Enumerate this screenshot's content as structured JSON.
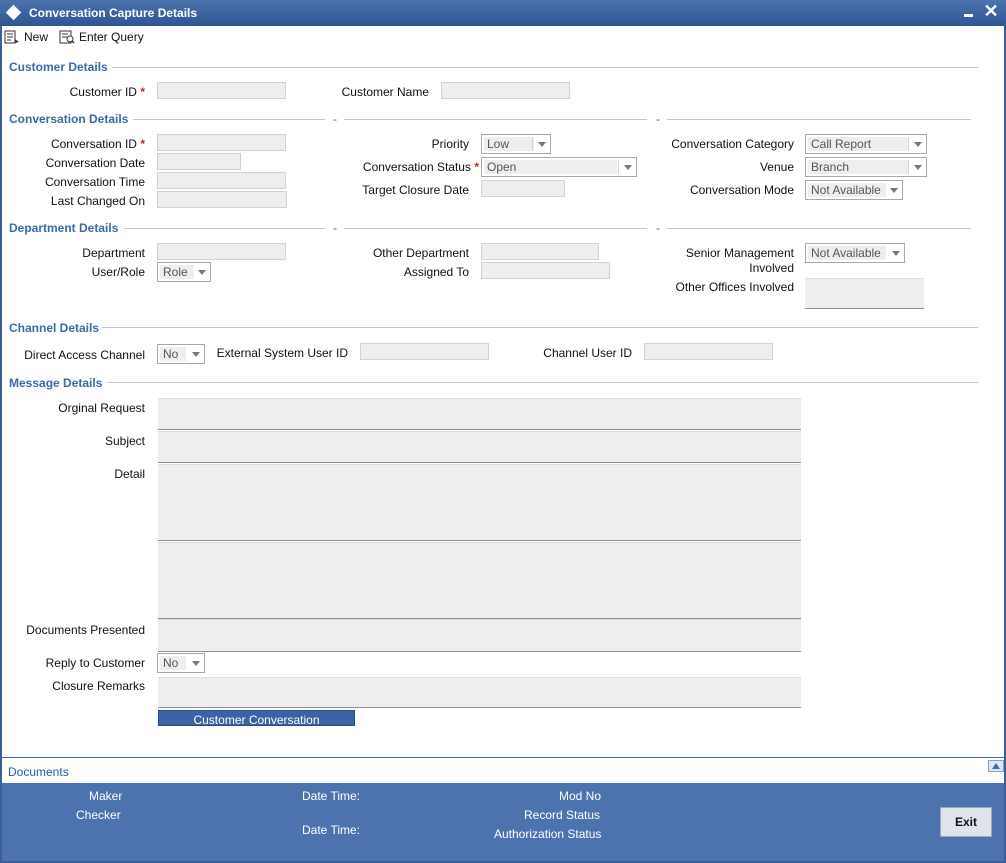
{
  "window": {
    "title": "Conversation Capture Details"
  },
  "toolbar": {
    "new_label": "New",
    "enter_query_label": "Enter Query"
  },
  "sections": {
    "customer": "Customer Details",
    "conversation": "Conversation Details",
    "department": "Department Details",
    "channel": "Channel Details",
    "message": "Message Details"
  },
  "customer": {
    "customer_id_label": "Customer ID",
    "customer_name_label": "Customer Name",
    "customer_id_value": "",
    "customer_name_value": ""
  },
  "conversation": {
    "conversation_id_label": "Conversation ID",
    "conversation_date_label": "Conversation Date",
    "conversation_time_label": "Conversation Time",
    "last_changed_on_label": "Last Changed On",
    "priority_label": "Priority",
    "priority_value": "Low",
    "status_label": "Conversation Status",
    "status_value": "Open",
    "target_closure_date_label": "Target Closure Date",
    "category_label": "Conversation Category",
    "category_value": "Call Report",
    "venue_label": "Venue",
    "venue_value": "Branch",
    "mode_label": "Conversation Mode",
    "mode_value": "Not Available"
  },
  "department": {
    "department_label": "Department",
    "user_role_label": "User/Role",
    "user_role_value": "Role",
    "other_department_label": "Other Department",
    "assigned_to_label": "Assigned To",
    "senior_mgmt_label_1": "Senior Management",
    "senior_mgmt_label_2": "Involved",
    "senior_mgmt_value": "Not Available",
    "other_offices_label": "Other Offices Involved"
  },
  "channel": {
    "direct_access_label": "Direct Access Channel",
    "direct_access_value": "No",
    "external_user_label": "External System User ID",
    "channel_user_label": "Channel User ID"
  },
  "message": {
    "original_request_label": "Orginal Request",
    "subject_label": "Subject",
    "detail_label": "Detail",
    "documents_presented_label": "Documents Presented",
    "reply_label": "Reply to Customer",
    "reply_value": "No",
    "closure_remarks_label": "Closure Remarks",
    "customer_conversation_button": "Customer Conversation"
  },
  "documents": {
    "link_label": "Documents"
  },
  "footer": {
    "maker_label": "Maker",
    "checker_label": "Checker",
    "date_time_label_1": "Date Time:",
    "date_time_label_2": "Date Time:",
    "mod_no_label": "Mod No",
    "record_status_label": "Record Status",
    "authorization_status_label": "Authorization Status",
    "exit_label": "Exit"
  },
  "colors": {
    "title_bar": "#2f5592",
    "section_head": "#3b6aa8",
    "footer": "#4c73ad",
    "required": "#cc2222"
  }
}
